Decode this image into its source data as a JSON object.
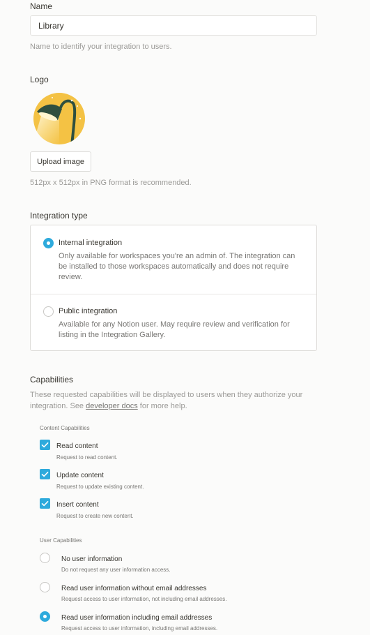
{
  "name": {
    "label": "Name",
    "value": "Library",
    "hint": "Name to identify your integration to users."
  },
  "logo": {
    "label": "Logo",
    "image_icon": "lamp-logo-icon",
    "upload_label": "Upload image",
    "hint": "512px x 512px in PNG format is recommended."
  },
  "integration_type": {
    "label": "Integration type",
    "options": [
      {
        "title": "Internal integration",
        "desc": "Only available for workspaces you're an admin of. The integration can be installed to those workspaces automatically and does not require review.",
        "selected": true
      },
      {
        "title": "Public integration",
        "desc": "Available for any Notion user. May require review and verification for listing in the Integration Gallery.",
        "selected": false
      }
    ]
  },
  "capabilities": {
    "label": "Capabilities",
    "desc_prefix": "These requested capabilities will be displayed to users when they authorize your integration. See ",
    "desc_link": "developer docs",
    "desc_suffix": " for more help.",
    "content_group_label": "Content Capabilities",
    "content": [
      {
        "title": "Read content",
        "desc": "Request to read content.",
        "checked": true
      },
      {
        "title": "Update content",
        "desc": "Request to update existing content.",
        "checked": true
      },
      {
        "title": "Insert content",
        "desc": "Request to create new content.",
        "checked": true
      }
    ],
    "user_group_label": "User Capabilities",
    "user": [
      {
        "title": "No user information",
        "desc": "Do not request any user information access.",
        "selected": false
      },
      {
        "title": "Read user information without email addresses",
        "desc": "Request access to user information, not including email addresses.",
        "selected": false
      },
      {
        "title": "Read user information including email addresses",
        "desc": "Request access to user information, including email addresses.",
        "selected": true
      }
    ]
  },
  "colors": {
    "accent": "#2eaadc",
    "logo_bg": "#f4c244",
    "lamp_shade": "#2f4f3f"
  }
}
